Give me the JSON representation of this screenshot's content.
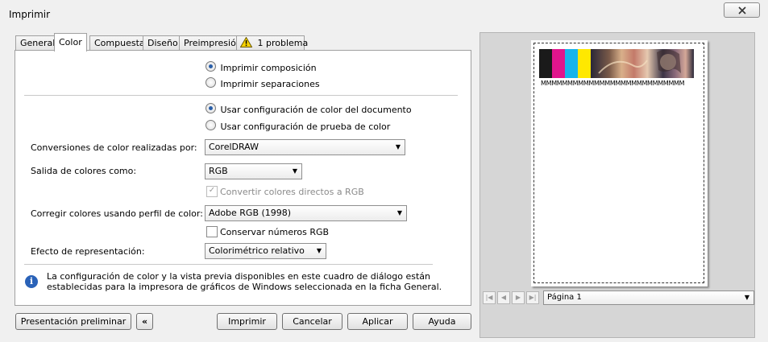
{
  "window": {
    "title": "Imprimir"
  },
  "tabs": [
    {
      "label": "General",
      "active": false
    },
    {
      "label": "Color",
      "active": true
    },
    {
      "label": "Compuesta",
      "active": false
    },
    {
      "label": "Diseño",
      "active": false
    },
    {
      "label": "Preimpresión",
      "active": false
    },
    {
      "label": "1 problema",
      "active": false,
      "icon": "warning-icon"
    }
  ],
  "output_mode": {
    "options": [
      "Imprimir composición",
      "Imprimir separaciones"
    ],
    "selected": 0
  },
  "color_config": {
    "options": [
      "Usar configuración de color del documento",
      "Usar configuración de prueba de color"
    ],
    "selected": 0
  },
  "conversions": {
    "label": "Conversiones de color realizadas por:",
    "value": "CorelDRAW"
  },
  "output_colors": {
    "label": "Salida de colores como:",
    "value": "RGB"
  },
  "convert_spot": {
    "label": "Convertir colores directos a RGB",
    "checked": true,
    "enabled": false
  },
  "correct_colors": {
    "label": "Corregir colores usando perfil de color:",
    "value": "Adobe RGB (1998)"
  },
  "preserve_numbers": {
    "label": "Conservar números RGB",
    "checked": false
  },
  "rendering_intent": {
    "label": "Efecto de representación:",
    "value": "Colorimétrico relativo"
  },
  "info": {
    "icon": "info-icon",
    "line1": "La configuración de color y la vista previa disponibles en este cuadro de diálogo están",
    "line2": "establecidas para la impresora de gráficos de Windows seleccionada en la ficha General."
  },
  "buttons": {
    "preview": "Presentación preliminar",
    "collapse": "«",
    "print": "Imprimir",
    "cancel": "Cancelar",
    "apply": "Aplicar",
    "help": "Ayuda"
  },
  "preview": {
    "sample_text": "MMMMMMMMMMMMMMMMMMMMMMMMMMM",
    "page_selector": "Página 1",
    "color_bars": [
      "#1a1a1a",
      "#e0158c",
      "#16b4ec",
      "#ffe800"
    ]
  },
  "colors": {
    "accent": "#2a5fa8",
    "info_blue": "#2a62b8",
    "warning_yellow": "#f7d200"
  }
}
